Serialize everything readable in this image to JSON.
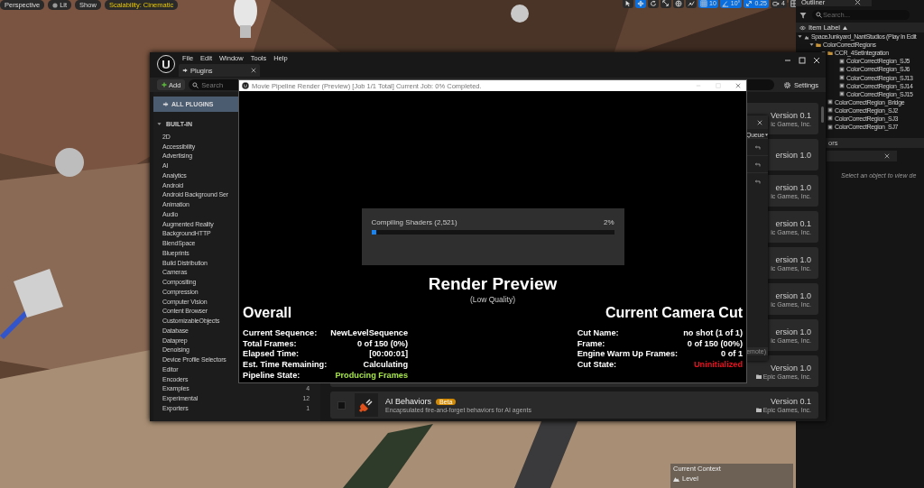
{
  "viewport": {
    "kind": "picture",
    "toolbar_left": [
      {
        "label": "Perspective",
        "kind": "plain"
      },
      {
        "label": "Lit",
        "kind": "lit"
      },
      {
        "label": "Show",
        "kind": "plain"
      },
      {
        "label": "Scalability: Cinematic",
        "kind": "warning"
      }
    ],
    "toolbar_right": [
      {
        "kind": "select",
        "selected": false
      },
      {
        "kind": "move",
        "selected": true
      },
      {
        "kind": "rotate",
        "selected": false
      },
      {
        "kind": "scale",
        "selected": false
      },
      {
        "kind": "world",
        "selected": false
      },
      {
        "kind": "surface",
        "selected": false
      },
      {
        "kind": "grid",
        "selected": true,
        "label": "10"
      },
      {
        "kind": "angle",
        "selected": true,
        "label": "10°"
      },
      {
        "kind": "scalesnap",
        "selected": true,
        "label": "0.25"
      },
      {
        "kind": "camera",
        "selected": false,
        "label": "4"
      },
      {
        "kind": "layout",
        "selected": false
      }
    ],
    "context": {
      "label": "Current Context",
      "value": "Level"
    }
  },
  "plugins": {
    "menu": [
      "File",
      "Edit",
      "Window",
      "Tools",
      "Help"
    ],
    "tab": "Plugins",
    "add_button": "Add",
    "search": {
      "placeholder": "Search"
    },
    "settings": "Settings",
    "sidebar": {
      "all": {
        "label": "ALL PLUGINS",
        "selected": true
      },
      "group": {
        "label": "BUILT-IN",
        "expanded": true,
        "children": [
          {
            "label": "2D",
            "selected": false
          },
          {
            "label": "Accessibility",
            "selected": false
          },
          {
            "label": "Advertising",
            "selected": false
          },
          {
            "label": "AI",
            "selected": false
          },
          {
            "label": "Analytics",
            "selected": false
          },
          {
            "label": "Android",
            "selected": false
          },
          {
            "label": "Android Background Ser",
            "selected": false
          },
          {
            "label": "Animation",
            "selected": false
          },
          {
            "label": "Audio",
            "selected": false
          },
          {
            "label": "Augmented Reality",
            "selected": false
          },
          {
            "label": "BackgroundHTTP",
            "selected": false
          },
          {
            "label": "BlendSpace",
            "selected": false
          },
          {
            "label": "Blueprints",
            "selected": false
          },
          {
            "label": "Build Distribution",
            "selected": false
          },
          {
            "label": "Cameras",
            "selected": false
          },
          {
            "label": "Compositing",
            "selected": false
          },
          {
            "label": "Compression",
            "selected": false
          },
          {
            "label": "Computer Vision",
            "selected": false
          },
          {
            "label": "Content Browser",
            "selected": false
          },
          {
            "label": "CustomizableObjects",
            "selected": false
          },
          {
            "label": "Database",
            "selected": false
          },
          {
            "label": "Dataprep",
            "selected": false
          },
          {
            "label": "Denoising",
            "selected": false
          },
          {
            "label": "Device Profile Selectors",
            "selected": false
          },
          {
            "label": "Editor",
            "selected": false
          },
          {
            "label": "Encoders",
            "selected": false
          },
          {
            "label": "Examples",
            "count": "4",
            "selected": false
          },
          {
            "label": "Experimental",
            "count": "12",
            "selected": false
          },
          {
            "label": "Exporters",
            "count": "1",
            "selected": false
          }
        ]
      }
    },
    "cards": [
      {
        "kind": "covered",
        "version": "Version 0.1",
        "publisher": "ic Games, Inc."
      },
      {
        "kind": "covered",
        "version": "ersion 1.0"
      },
      {
        "kind": "covered",
        "version": "ersion 1.0",
        "publisher": "ic Games, Inc."
      },
      {
        "kind": "covered",
        "version": "ersion 0.1",
        "publisher": "ic Games, Inc."
      },
      {
        "kind": "covered",
        "version": "ersion 1.0",
        "publisher": "ic Games, Inc."
      },
      {
        "kind": "covered",
        "version": "ersion 1.0",
        "publisher": "ic Games, Inc."
      },
      {
        "kind": "covered",
        "version": "ersion 1.0",
        "publisher": "ic Games, Inc."
      },
      {
        "kind": "plain",
        "version": "Version 1.0",
        "publisher": "Epic Games, Inc."
      },
      {
        "kind": "detailed",
        "name": "AI Behaviors",
        "badge": "Beta",
        "description": "Encapsulated fire-and-forget behaviors for AI agents",
        "checked": false,
        "version": "Version 0.1",
        "publisher": "Epic Games, Inc."
      }
    ]
  },
  "queue_window": {
    "dropdown": "Queue",
    "footer": "emote)"
  },
  "render": {
    "title": "Movie Pipeline Render (Preview) [Job 1/1 Total] Current Job: 0% Completed.",
    "progress": {
      "label": "Compiling Shaders (2,521)",
      "percent": "2%",
      "level": 0.02
    },
    "heading": "Render Preview",
    "subheading": "(Low Quality)",
    "overall": {
      "title": "Overall",
      "rows": [
        {
          "label": "Current Sequence:",
          "value": "NewLevelSequence"
        },
        {
          "label": "Total Frames:",
          "value": "0 of 150 (0%)"
        },
        {
          "label": "Elapsed Time:",
          "value": "[00:00:01]"
        },
        {
          "label": "Est. Time Remaining:",
          "value": "Calculating"
        },
        {
          "label": "Pipeline State:",
          "value": "Producing Frames",
          "color": "#a6e34a"
        }
      ]
    },
    "camera_cut": {
      "title": "Current Camera Cut",
      "rows": [
        {
          "label": "Cut Name:",
          "value": "no shot (1 of 1)"
        },
        {
          "label": "Frame:",
          "value": "0 of 150 (00%)"
        },
        {
          "label": "Engine Warm Up Frames:",
          "value": "0 of 1"
        },
        {
          "label": "Cut State:",
          "value": "Uninitialized",
          "color": "#e8101e"
        }
      ]
    }
  },
  "outliner": {
    "tab": "Outliner",
    "search": {
      "placeholder": "Search..."
    },
    "column": "Item Label",
    "tree": [
      {
        "label": "SpaceJunkyard_NantStudios (Play In Edit",
        "kind": "world",
        "expanded": true,
        "children": [
          {
            "label": "ColorCorrectRegions",
            "kind": "folder",
            "expanded": true,
            "children": [
              {
                "label": "CCR_4SetIntegration",
                "kind": "folder",
                "expanded": true,
                "children": [
                  {
                    "label": "ColorCorrectRegion_SJ5",
                    "kind": "actor"
                  },
                  {
                    "label": "ColorCorrectRegion_SJ6",
                    "kind": "actor"
                  },
                  {
                    "label": "ColorCorrectRegion_SJ13",
                    "kind": "actor"
                  },
                  {
                    "label": "ColorCorrectRegion_SJ14",
                    "kind": "actor"
                  },
                  {
                    "label": "ColorCorrectRegion_SJ15",
                    "kind": "actor"
                  }
                ]
              },
              {
                "label": "ColorCorrectRegion_Bridge",
                "kind": "actor"
              },
              {
                "label": "ColorCorrectRegion_SJ2",
                "kind": "actor"
              },
              {
                "label": "ColorCorrectRegion_SJ3",
                "kind": "actor"
              },
              {
                "label": "ColorCorrectRegion_SJ7",
                "kind": "actor"
              }
            ]
          }
        ]
      }
    ]
  },
  "details": {
    "header": "ors",
    "message": "Select an object to view de"
  }
}
